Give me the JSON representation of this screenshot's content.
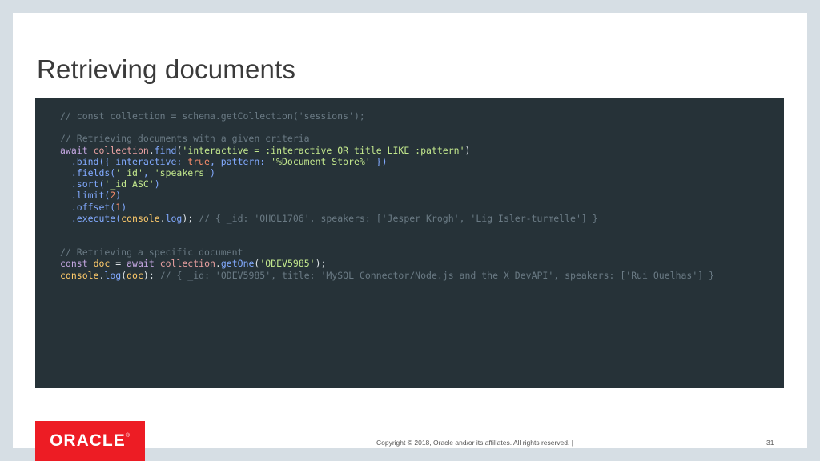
{
  "slide": {
    "title": "Retrieving documents"
  },
  "code": {
    "line1": "// const collection = schema.getCollection('sessions');",
    "line3": "// Retrieving documents with a given criteria",
    "l4_await": "await",
    "l4_collection": "collection",
    "l4_dot": ".",
    "l4_find": "find",
    "l4_open": "(",
    "l4_str": "'interactive = :interactive OR title LIKE :pattern'",
    "l4_close": ")",
    "l5_bind": "  .bind({ interactive: ",
    "l5_true": "true",
    "l5_mid": ", pattern: ",
    "l5_str": "'%Document Store%'",
    "l5_end": " })",
    "l6_fields": "  .fields(",
    "l6_s1": "'_id'",
    "l6_comma": ", ",
    "l6_s2": "'speakers'",
    "l6_end": ")",
    "l7_sort": "  .sort(",
    "l7_str": "'_id ASC'",
    "l7_end": ")",
    "l8_limit": "  .limit(",
    "l8_num": "2",
    "l8_end": ")",
    "l9_offset": "  .offset(",
    "l9_num": "1",
    "l9_end": ")",
    "l10_exec": "  .execute(",
    "l10_console": "console",
    "l10_dot": ".",
    "l10_log": "log",
    "l10_end": "); ",
    "l10_comment": "// { _id: 'OHOL1706', speakers: ['Jesper Krogh', 'Lig Isler-turmelle'] }",
    "line13": "// Retrieving a specific document",
    "l14_const": "const",
    "l14_doc": "doc",
    "l14_eq": " = ",
    "l14_await": "await",
    "l14_collection": "collection",
    "l14_dot": ".",
    "l14_getone": "getOne",
    "l14_open": "(",
    "l14_str": "'ODEV5985'",
    "l14_end": ");",
    "l15_console": "console",
    "l15_dot": ".",
    "l15_log": "log",
    "l15_open": "(",
    "l15_doc": "doc",
    "l15_end": "); ",
    "l15_comment": "// { _id: 'ODEV5985', title: 'MySQL Connector/Node.js and the X DevAPI', speakers: ['Rui Quelhas'] }"
  },
  "footer": {
    "logo": "ORACLE",
    "logo_mark": "®",
    "copyright": "Copyright © 2018, Oracle and/or its affiliates. All rights reserved.  |",
    "page_number": "31"
  }
}
